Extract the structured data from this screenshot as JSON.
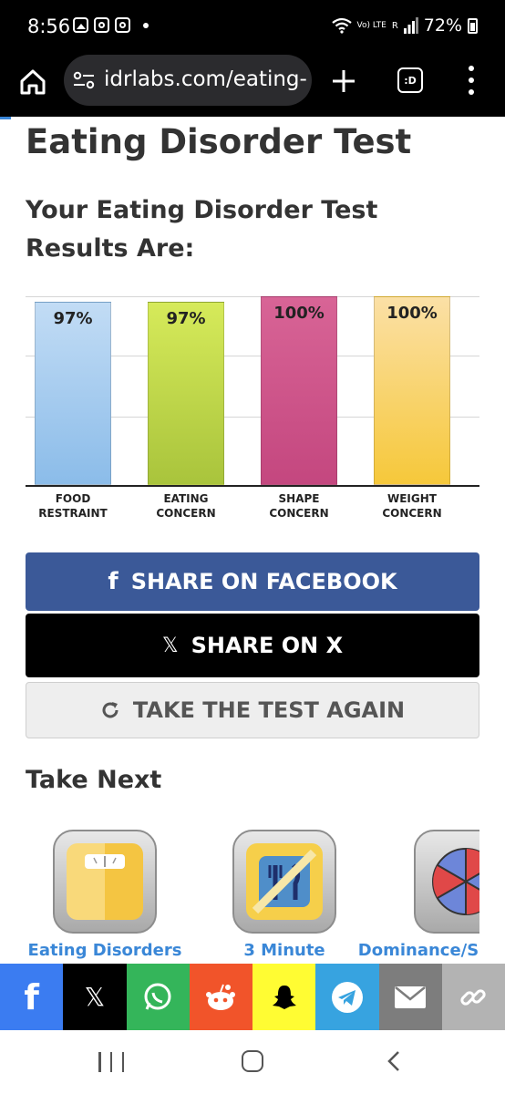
{
  "status_bar": {
    "time": "8:56",
    "lte_label": "Vo) LTE",
    "signal_label": "R",
    "battery": "72%"
  },
  "browser": {
    "url": "idrlabs.com/eating-c",
    "tabs_label": ":D"
  },
  "page": {
    "title": "Eating Disorder Test",
    "results_heading": "Your Eating Disorder Test Results Are:"
  },
  "chart_data": {
    "type": "bar",
    "categories": [
      "FOOD RESTRAINT",
      "EATING CONCERN",
      "SHAPE CONCERN",
      "WEIGHT CONCERN"
    ],
    "category_lines": [
      [
        "FOOD",
        "RESTRAINT"
      ],
      [
        "EATING",
        "CONCERN"
      ],
      [
        "SHAPE",
        "CONCERN"
      ],
      [
        "WEIGHT",
        "CONCERN"
      ]
    ],
    "values": [
      97,
      97,
      100,
      100
    ],
    "value_labels": [
      "97%",
      "97%",
      "100%",
      "100%"
    ],
    "colors": [
      [
        "#c2dcf5",
        "#8bbce9"
      ],
      [
        "#d6ea5a",
        "#a9c43c"
      ],
      [
        "#d86496",
        "#c4477f"
      ],
      [
        "#fbe0a6",
        "#f6c83a"
      ]
    ],
    "ylim": [
      0,
      100
    ],
    "grid": true,
    "title": "",
    "xlabel": "",
    "ylabel": ""
  },
  "buttons": {
    "facebook": "SHARE ON FACEBOOK",
    "x": "SHARE ON X",
    "again": "TAKE THE TEST AGAIN"
  },
  "take_next": {
    "heading": "Take Next",
    "items": [
      {
        "label": "Eating Disorders",
        "icon": "scale-icon"
      },
      {
        "label": "3 Minute",
        "icon": "no-food-icon"
      },
      {
        "label": "Dominance/S",
        "icon": "pie-wheel-icon"
      }
    ]
  },
  "share_bar": {
    "items": [
      {
        "name": "facebook",
        "color": "#3b7cf1"
      },
      {
        "name": "x",
        "color": "#000000"
      },
      {
        "name": "whatsapp",
        "color": "#34b55a"
      },
      {
        "name": "reddit",
        "color": "#f1542a"
      },
      {
        "name": "snapchat",
        "color": "#fffc33"
      },
      {
        "name": "telegram",
        "color": "#37a3e0"
      },
      {
        "name": "email",
        "color": "#7d7d7d"
      },
      {
        "name": "copy-link",
        "color": "#b3b3b3"
      }
    ]
  },
  "colors": {
    "accent_link": "#3a87d7",
    "facebook_blue": "#3b5998"
  }
}
